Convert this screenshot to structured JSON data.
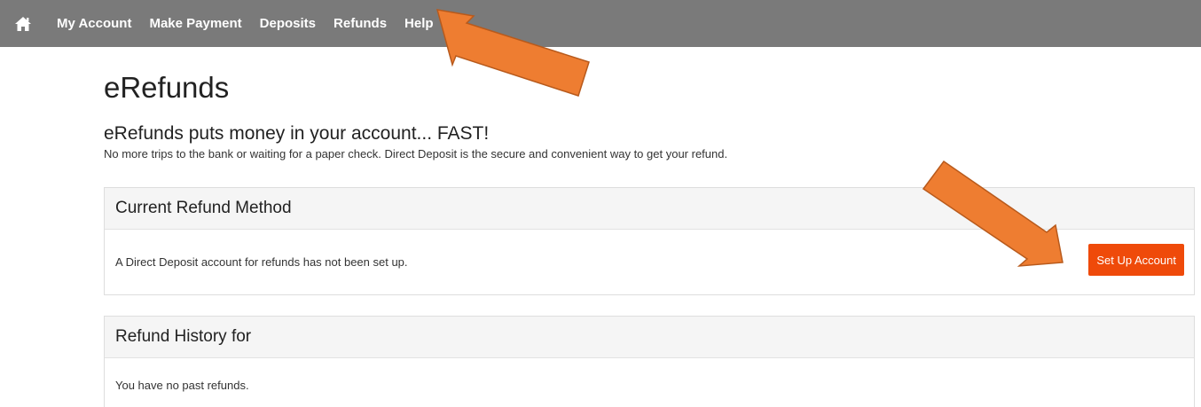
{
  "nav": {
    "home_icon": "home-icon",
    "items": [
      {
        "label": "My Account"
      },
      {
        "label": "Make Payment"
      },
      {
        "label": "Deposits"
      },
      {
        "label": "Refunds"
      },
      {
        "label": "Help"
      }
    ]
  },
  "page": {
    "title": "eRefunds",
    "subtitle": "eRefunds puts money in your account... FAST!",
    "intro": "No more trips to the bank or waiting for a paper check. Direct Deposit is the secure and convenient way to get your refund."
  },
  "current_method": {
    "heading": "Current Refund Method",
    "message": "A Direct Deposit account for refunds has not been set up.",
    "button_label": "Set Up Account"
  },
  "history": {
    "heading": "Refund History for",
    "message": "You have no past refunds."
  },
  "colors": {
    "navbar": "#7a7a7a",
    "accent_button": "#ef4a0a",
    "annotation_arrow": "#ee7d31"
  },
  "annotations": [
    "arrow-icon",
    "arrow-icon"
  ]
}
